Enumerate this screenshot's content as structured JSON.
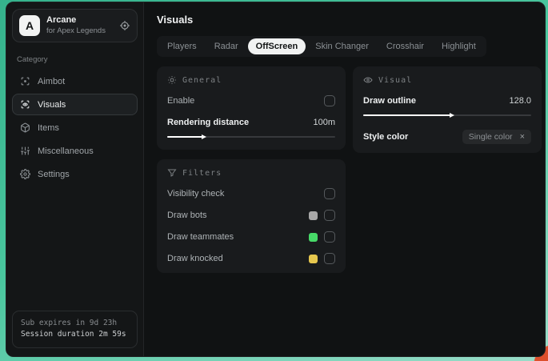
{
  "sidebar": {
    "brand": {
      "initial": "A",
      "name": "Arcane",
      "subtitle": "for Apex Legends"
    },
    "category_label": "Category",
    "items": [
      {
        "label": "Aimbot"
      },
      {
        "label": "Visuals"
      },
      {
        "label": "Items"
      },
      {
        "label": "Miscellaneous"
      },
      {
        "label": "Settings"
      }
    ],
    "footer": {
      "line1": "Sub expires in 9d 23h",
      "line2": "Session duration 2m 59s"
    }
  },
  "header": {
    "title": "Visuals"
  },
  "tabs": [
    {
      "label": "Players"
    },
    {
      "label": "Radar"
    },
    {
      "label": "OffScreen"
    },
    {
      "label": "Skin Changer"
    },
    {
      "label": "Crosshair"
    },
    {
      "label": "Highlight"
    }
  ],
  "panels": {
    "general": {
      "title": "General",
      "enable_label": "Enable",
      "rendering_label": "Rendering distance",
      "rendering_value": "100m",
      "rendering_fill": "21%"
    },
    "visual": {
      "title": "Visual",
      "outline_label": "Draw outline",
      "outline_value": "128.0",
      "outline_fill": "52%",
      "style_label": "Style color",
      "style_chip": "Single color",
      "chip_close": "×"
    },
    "filters": {
      "title": "Filters",
      "rows": [
        {
          "label": "Visibility check",
          "swatch": null
        },
        {
          "label": "Draw bots",
          "swatch": "#a8a8a8"
        },
        {
          "label": "Draw teammates",
          "swatch": "#47d968"
        },
        {
          "label": "Draw knocked",
          "swatch": "#e6c74e"
        }
      ]
    }
  },
  "colors": {
    "accent_teal": "#49c69e",
    "corner_red": "#dd4f2c",
    "window_bg": "#101213",
    "panel_bg": "#191b1d",
    "tab_selected_bg": "#f1f2f2"
  }
}
